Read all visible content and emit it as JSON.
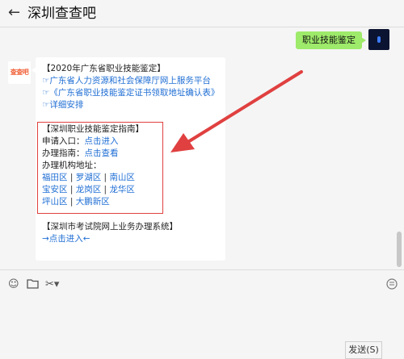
{
  "window": {
    "title": "深圳查查吧"
  },
  "messages": {
    "sent": {
      "text": "职业技能鉴定"
    },
    "received": {
      "avatar_text": "查查吧",
      "lines": [
        {
          "text": "【2020年广东省职业技能鉴定】"
        },
        {
          "text": "☞广东省人力资源和社会保障厅网上服务平台"
        },
        {
          "text": "☞《广东省职业技能鉴定证书领取地址确认表》"
        },
        {
          "text": "☞详细安排"
        },
        {
          "text": "【深圳职业技能鉴定指南】"
        },
        {
          "text": "申请入口："
        },
        {
          "text": "点击进入"
        },
        {
          "text": "办理指南："
        },
        {
          "text": "点击查看"
        },
        {
          "text": "办理机构地址："
        }
      ],
      "districts": [
        [
          "福田区",
          "罗湖区",
          "南山区"
        ],
        [
          "宝安区",
          "龙岗区",
          "龙华区"
        ],
        [
          "坪山区",
          "大鹏新区"
        ]
      ],
      "separator": " | ",
      "exam_section": {
        "title": "【深圳市考试院网上业务办理系统】",
        "link": "→点击进入←"
      }
    }
  },
  "input": {
    "send_label": "发送(S)"
  },
  "colors": {
    "link": "#1f6ed4",
    "bubble_sent": "#9eea6a",
    "highlight": "#e04040"
  }
}
